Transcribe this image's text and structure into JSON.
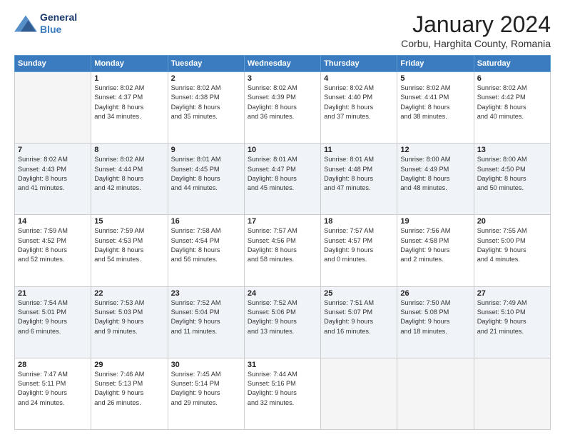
{
  "logo": {
    "line1": "General",
    "line2": "Blue"
  },
  "title": "January 2024",
  "subtitle": "Corbu, Harghita County, Romania",
  "weekdays": [
    "Sunday",
    "Monday",
    "Tuesday",
    "Wednesday",
    "Thursday",
    "Friday",
    "Saturday"
  ],
  "weeks": [
    [
      {
        "day": null
      },
      {
        "day": 1,
        "sunrise": "8:02 AM",
        "sunset": "4:37 PM",
        "daylight": "8 hours and 34 minutes."
      },
      {
        "day": 2,
        "sunrise": "8:02 AM",
        "sunset": "4:38 PM",
        "daylight": "8 hours and 35 minutes."
      },
      {
        "day": 3,
        "sunrise": "8:02 AM",
        "sunset": "4:39 PM",
        "daylight": "8 hours and 36 minutes."
      },
      {
        "day": 4,
        "sunrise": "8:02 AM",
        "sunset": "4:40 PM",
        "daylight": "8 hours and 37 minutes."
      },
      {
        "day": 5,
        "sunrise": "8:02 AM",
        "sunset": "4:41 PM",
        "daylight": "8 hours and 38 minutes."
      },
      {
        "day": 6,
        "sunrise": "8:02 AM",
        "sunset": "4:42 PM",
        "daylight": "8 hours and 40 minutes."
      }
    ],
    [
      {
        "day": 7,
        "sunrise": "8:02 AM",
        "sunset": "4:43 PM",
        "daylight": "8 hours and 41 minutes."
      },
      {
        "day": 8,
        "sunrise": "8:02 AM",
        "sunset": "4:44 PM",
        "daylight": "8 hours and 42 minutes."
      },
      {
        "day": 9,
        "sunrise": "8:01 AM",
        "sunset": "4:45 PM",
        "daylight": "8 hours and 44 minutes."
      },
      {
        "day": 10,
        "sunrise": "8:01 AM",
        "sunset": "4:47 PM",
        "daylight": "8 hours and 45 minutes."
      },
      {
        "day": 11,
        "sunrise": "8:01 AM",
        "sunset": "4:48 PM",
        "daylight": "8 hours and 47 minutes."
      },
      {
        "day": 12,
        "sunrise": "8:00 AM",
        "sunset": "4:49 PM",
        "daylight": "8 hours and 48 minutes."
      },
      {
        "day": 13,
        "sunrise": "8:00 AM",
        "sunset": "4:50 PM",
        "daylight": "8 hours and 50 minutes."
      }
    ],
    [
      {
        "day": 14,
        "sunrise": "7:59 AM",
        "sunset": "4:52 PM",
        "daylight": "8 hours and 52 minutes."
      },
      {
        "day": 15,
        "sunrise": "7:59 AM",
        "sunset": "4:53 PM",
        "daylight": "8 hours and 54 minutes."
      },
      {
        "day": 16,
        "sunrise": "7:58 AM",
        "sunset": "4:54 PM",
        "daylight": "8 hours and 56 minutes."
      },
      {
        "day": 17,
        "sunrise": "7:57 AM",
        "sunset": "4:56 PM",
        "daylight": "8 hours and 58 minutes."
      },
      {
        "day": 18,
        "sunrise": "7:57 AM",
        "sunset": "4:57 PM",
        "daylight": "9 hours and 0 minutes."
      },
      {
        "day": 19,
        "sunrise": "7:56 AM",
        "sunset": "4:58 PM",
        "daylight": "9 hours and 2 minutes."
      },
      {
        "day": 20,
        "sunrise": "7:55 AM",
        "sunset": "5:00 PM",
        "daylight": "9 hours and 4 minutes."
      }
    ],
    [
      {
        "day": 21,
        "sunrise": "7:54 AM",
        "sunset": "5:01 PM",
        "daylight": "9 hours and 6 minutes."
      },
      {
        "day": 22,
        "sunrise": "7:53 AM",
        "sunset": "5:03 PM",
        "daylight": "9 hours and 9 minutes."
      },
      {
        "day": 23,
        "sunrise": "7:52 AM",
        "sunset": "5:04 PM",
        "daylight": "9 hours and 11 minutes."
      },
      {
        "day": 24,
        "sunrise": "7:52 AM",
        "sunset": "5:06 PM",
        "daylight": "9 hours and 13 minutes."
      },
      {
        "day": 25,
        "sunrise": "7:51 AM",
        "sunset": "5:07 PM",
        "daylight": "9 hours and 16 minutes."
      },
      {
        "day": 26,
        "sunrise": "7:50 AM",
        "sunset": "5:08 PM",
        "daylight": "9 hours and 18 minutes."
      },
      {
        "day": 27,
        "sunrise": "7:49 AM",
        "sunset": "5:10 PM",
        "daylight": "9 hours and 21 minutes."
      }
    ],
    [
      {
        "day": 28,
        "sunrise": "7:47 AM",
        "sunset": "5:11 PM",
        "daylight": "9 hours and 24 minutes."
      },
      {
        "day": 29,
        "sunrise": "7:46 AM",
        "sunset": "5:13 PM",
        "daylight": "9 hours and 26 minutes."
      },
      {
        "day": 30,
        "sunrise": "7:45 AM",
        "sunset": "5:14 PM",
        "daylight": "9 hours and 29 minutes."
      },
      {
        "day": 31,
        "sunrise": "7:44 AM",
        "sunset": "5:16 PM",
        "daylight": "9 hours and 32 minutes."
      },
      {
        "day": null
      },
      {
        "day": null
      },
      {
        "day": null
      }
    ]
  ]
}
